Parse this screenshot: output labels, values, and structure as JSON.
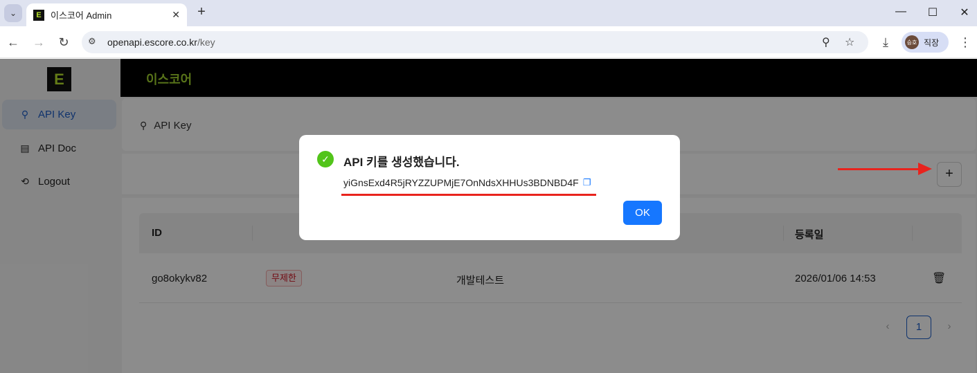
{
  "browser": {
    "tab_title": "이스코어 Admin",
    "favicon_letter": "E",
    "new_tab": "+",
    "url_host": "openapi.escore.co.kr",
    "url_path": "/key",
    "profile_avatar": "승호",
    "profile_name": "직장"
  },
  "app": {
    "logo_letter": "E",
    "brand": "이스코어",
    "sidebar": [
      {
        "label": "API Key",
        "icon": "search-icon",
        "active": true
      },
      {
        "label": "API Doc",
        "icon": "document-icon",
        "active": false
      },
      {
        "label": "Logout",
        "icon": "logout-icon",
        "active": false
      }
    ],
    "breadcrumb": "API Key",
    "add_button": "+",
    "table": {
      "headers": [
        "ID",
        "등록일"
      ],
      "rows": [
        {
          "id": "go8okykv82",
          "badge": "무제한",
          "name": "개발테스트",
          "date": "2026/01/06 14:53"
        }
      ]
    },
    "pagination": {
      "current": "1"
    }
  },
  "dialog": {
    "title": "API 키를 생성했습니다.",
    "key": "yiGnsExd4R5jRYZZUPMjE7OnNdsXHHUs3BDNBD4F",
    "ok_label": "OK"
  },
  "colors": {
    "accent": "#1677ff",
    "brand_green": "#a0d22e",
    "success": "#52c41a",
    "annotation_red": "#e8231d"
  }
}
